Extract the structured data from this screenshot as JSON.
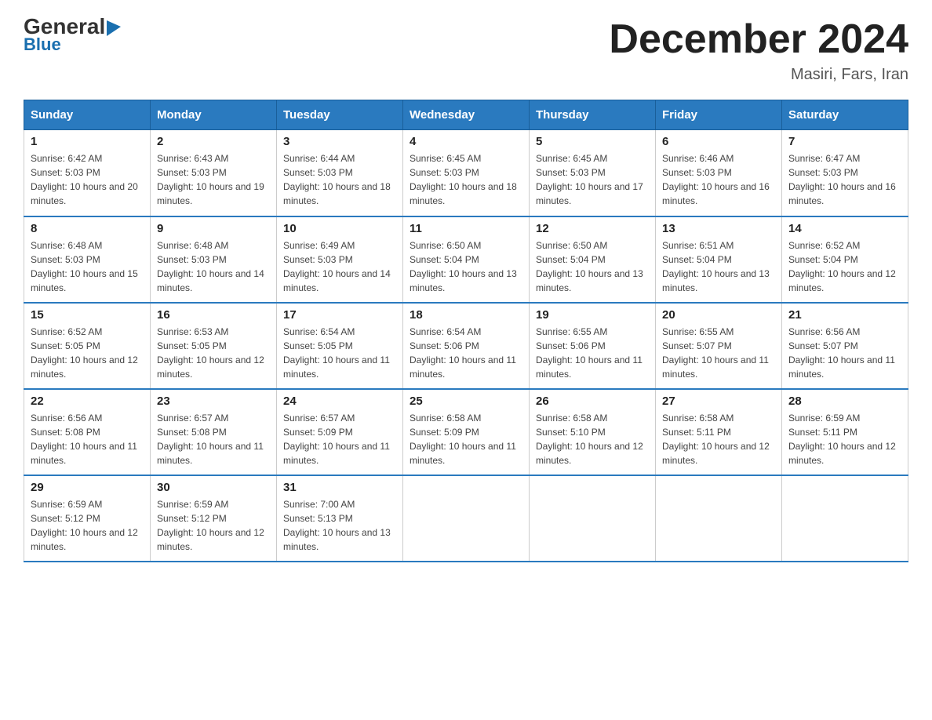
{
  "header": {
    "logo_part1": "General",
    "logo_part2": "Blue",
    "month_title": "December 2024",
    "location": "Masiri, Fars, Iran"
  },
  "days_of_week": [
    "Sunday",
    "Monday",
    "Tuesday",
    "Wednesday",
    "Thursday",
    "Friday",
    "Saturday"
  ],
  "weeks": [
    [
      {
        "date": "1",
        "sunrise": "6:42 AM",
        "sunset": "5:03 PM",
        "daylight": "10 hours and 20 minutes."
      },
      {
        "date": "2",
        "sunrise": "6:43 AM",
        "sunset": "5:03 PM",
        "daylight": "10 hours and 19 minutes."
      },
      {
        "date": "3",
        "sunrise": "6:44 AM",
        "sunset": "5:03 PM",
        "daylight": "10 hours and 18 minutes."
      },
      {
        "date": "4",
        "sunrise": "6:45 AM",
        "sunset": "5:03 PM",
        "daylight": "10 hours and 18 minutes."
      },
      {
        "date": "5",
        "sunrise": "6:45 AM",
        "sunset": "5:03 PM",
        "daylight": "10 hours and 17 minutes."
      },
      {
        "date": "6",
        "sunrise": "6:46 AM",
        "sunset": "5:03 PM",
        "daylight": "10 hours and 16 minutes."
      },
      {
        "date": "7",
        "sunrise": "6:47 AM",
        "sunset": "5:03 PM",
        "daylight": "10 hours and 16 minutes."
      }
    ],
    [
      {
        "date": "8",
        "sunrise": "6:48 AM",
        "sunset": "5:03 PM",
        "daylight": "10 hours and 15 minutes."
      },
      {
        "date": "9",
        "sunrise": "6:48 AM",
        "sunset": "5:03 PM",
        "daylight": "10 hours and 14 minutes."
      },
      {
        "date": "10",
        "sunrise": "6:49 AM",
        "sunset": "5:03 PM",
        "daylight": "10 hours and 14 minutes."
      },
      {
        "date": "11",
        "sunrise": "6:50 AM",
        "sunset": "5:04 PM",
        "daylight": "10 hours and 13 minutes."
      },
      {
        "date": "12",
        "sunrise": "6:50 AM",
        "sunset": "5:04 PM",
        "daylight": "10 hours and 13 minutes."
      },
      {
        "date": "13",
        "sunrise": "6:51 AM",
        "sunset": "5:04 PM",
        "daylight": "10 hours and 13 minutes."
      },
      {
        "date": "14",
        "sunrise": "6:52 AM",
        "sunset": "5:04 PM",
        "daylight": "10 hours and 12 minutes."
      }
    ],
    [
      {
        "date": "15",
        "sunrise": "6:52 AM",
        "sunset": "5:05 PM",
        "daylight": "10 hours and 12 minutes."
      },
      {
        "date": "16",
        "sunrise": "6:53 AM",
        "sunset": "5:05 PM",
        "daylight": "10 hours and 12 minutes."
      },
      {
        "date": "17",
        "sunrise": "6:54 AM",
        "sunset": "5:05 PM",
        "daylight": "10 hours and 11 minutes."
      },
      {
        "date": "18",
        "sunrise": "6:54 AM",
        "sunset": "5:06 PM",
        "daylight": "10 hours and 11 minutes."
      },
      {
        "date": "19",
        "sunrise": "6:55 AM",
        "sunset": "5:06 PM",
        "daylight": "10 hours and 11 minutes."
      },
      {
        "date": "20",
        "sunrise": "6:55 AM",
        "sunset": "5:07 PM",
        "daylight": "10 hours and 11 minutes."
      },
      {
        "date": "21",
        "sunrise": "6:56 AM",
        "sunset": "5:07 PM",
        "daylight": "10 hours and 11 minutes."
      }
    ],
    [
      {
        "date": "22",
        "sunrise": "6:56 AM",
        "sunset": "5:08 PM",
        "daylight": "10 hours and 11 minutes."
      },
      {
        "date": "23",
        "sunrise": "6:57 AM",
        "sunset": "5:08 PM",
        "daylight": "10 hours and 11 minutes."
      },
      {
        "date": "24",
        "sunrise": "6:57 AM",
        "sunset": "5:09 PM",
        "daylight": "10 hours and 11 minutes."
      },
      {
        "date": "25",
        "sunrise": "6:58 AM",
        "sunset": "5:09 PM",
        "daylight": "10 hours and 11 minutes."
      },
      {
        "date": "26",
        "sunrise": "6:58 AM",
        "sunset": "5:10 PM",
        "daylight": "10 hours and 12 minutes."
      },
      {
        "date": "27",
        "sunrise": "6:58 AM",
        "sunset": "5:11 PM",
        "daylight": "10 hours and 12 minutes."
      },
      {
        "date": "28",
        "sunrise": "6:59 AM",
        "sunset": "5:11 PM",
        "daylight": "10 hours and 12 minutes."
      }
    ],
    [
      {
        "date": "29",
        "sunrise": "6:59 AM",
        "sunset": "5:12 PM",
        "daylight": "10 hours and 12 minutes."
      },
      {
        "date": "30",
        "sunrise": "6:59 AM",
        "sunset": "5:12 PM",
        "daylight": "10 hours and 12 minutes."
      },
      {
        "date": "31",
        "sunrise": "7:00 AM",
        "sunset": "5:13 PM",
        "daylight": "10 hours and 13 minutes."
      },
      null,
      null,
      null,
      null
    ]
  ],
  "labels": {
    "sunrise": "Sunrise:",
    "sunset": "Sunset:",
    "daylight": "Daylight:"
  }
}
